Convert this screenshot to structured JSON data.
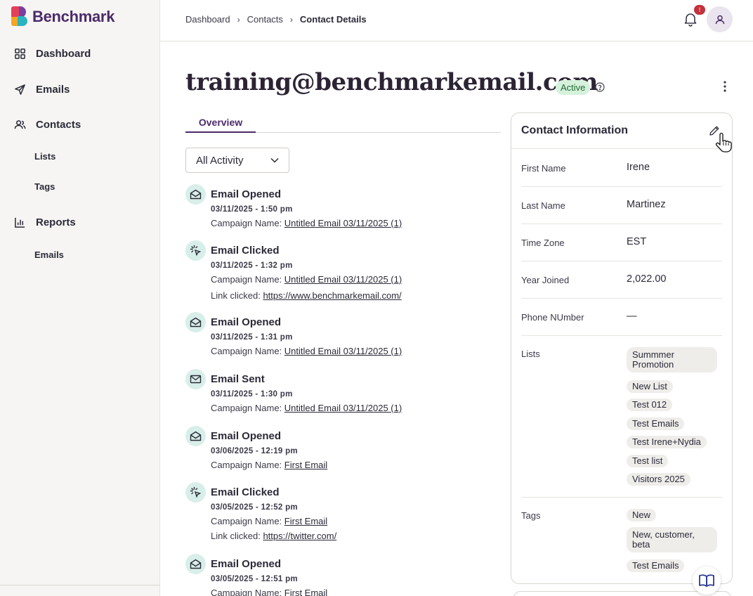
{
  "brand": {
    "name": "Benchmark"
  },
  "sidebar": {
    "items": [
      {
        "label": "Dashboard",
        "icon": "grid-icon"
      },
      {
        "label": "Emails",
        "icon": "send-icon"
      },
      {
        "label": "Contacts",
        "icon": "users-icon"
      },
      {
        "label": "Lists"
      },
      {
        "label": "Tags"
      },
      {
        "label": "Reports",
        "icon": "bar-chart-icon"
      },
      {
        "label": "Emails"
      }
    ]
  },
  "topbar": {
    "breadcrumb": [
      "Dashboard",
      "Contacts",
      "Contact Details"
    ],
    "notification_count": "!"
  },
  "contact": {
    "email": "training@benchmarkemail.com",
    "status": "Active"
  },
  "tabs": {
    "overview": "Overview"
  },
  "filter": {
    "selected": "All Activity"
  },
  "activity": [
    {
      "title": "Email Opened",
      "date": "03/11/2025 - 1:50 pm",
      "campaign_label": "Campaign Name:",
      "campaign": "Untitled Email 03/11/2025 (1)"
    },
    {
      "title": "Email Clicked",
      "date": "03/11/2025 - 1:32 pm",
      "campaign_label": "Campaign Name:",
      "campaign": "Untitled Email 03/11/2025 (1)",
      "link_label": "Link clicked:",
      "link": "https://www.benchmarkemail.com/"
    },
    {
      "title": "Email Opened",
      "date": "03/11/2025 - 1:31 pm",
      "campaign_label": "Campaign Name:",
      "campaign": "Untitled Email 03/11/2025 (1)"
    },
    {
      "title": "Email Sent",
      "date": "03/11/2025 - 1:30 pm",
      "campaign_label": "Campaign Name:",
      "campaign": "Untitled Email 03/11/2025 (1)"
    },
    {
      "title": "Email Opened",
      "date": "03/06/2025 - 12:19 pm",
      "campaign_label": "Campaign Name:",
      "campaign": "First Email"
    },
    {
      "title": "Email Clicked",
      "date": "03/05/2025 - 12:52 pm",
      "campaign_label": "Campaign Name:",
      "campaign": "First Email",
      "link_label": "Link clicked:",
      "link": "https://twitter.com/"
    },
    {
      "title": "Email Opened",
      "date": "03/05/2025 - 12:51 pm",
      "campaign_label": "Campaign Name:",
      "campaign": "First Email"
    }
  ],
  "contact_info": {
    "title": "Contact Information",
    "fields": [
      {
        "label": "First Name",
        "value": "Irene"
      },
      {
        "label": "Last Name",
        "value": "Martinez"
      },
      {
        "label": "Time Zone",
        "value": "EST"
      },
      {
        "label": "Year Joined",
        "value": "2,022.00"
      },
      {
        "label": "Phone NUmber",
        "value": "—"
      }
    ],
    "lists_label": "Lists",
    "lists": [
      "Summmer Promotion",
      "New List",
      "Test 012",
      "Test Emails",
      "Test Irene+Nydia",
      "Test list",
      "Visitors 2025"
    ],
    "tags_label": "Tags",
    "tags": [
      "New",
      "New, customer, beta",
      "Test Emails"
    ]
  },
  "colors": {
    "brand_purple": "#4b2a6b",
    "active_green_bg": "#d6f1dc",
    "icon_teal_bg": "#d8efe9",
    "badge_red": "#c2313c"
  }
}
